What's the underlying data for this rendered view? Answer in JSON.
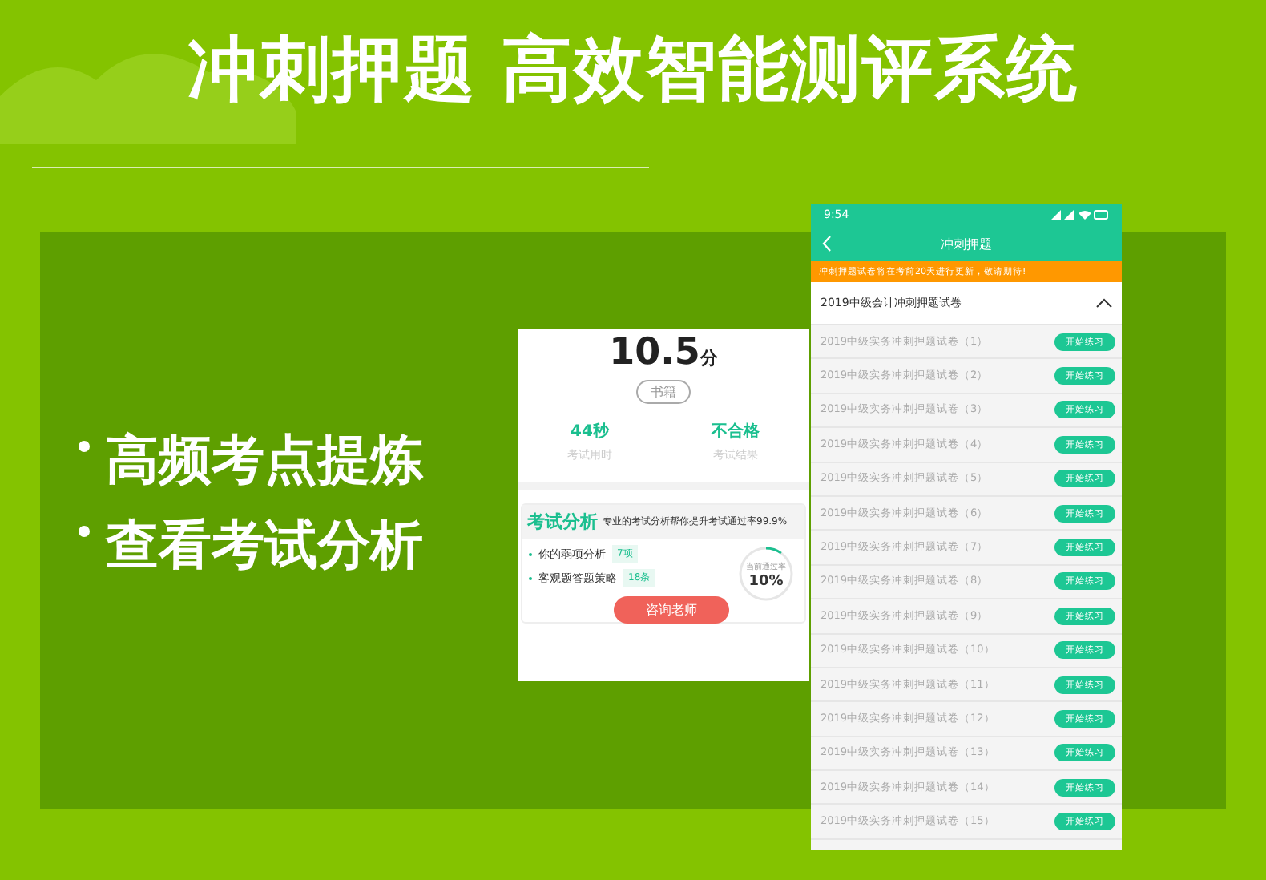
{
  "headline": "冲刺押题 高效智能测评系统",
  "features": [
    "高频考点提炼",
    "查看考试分析"
  ],
  "result_card": {
    "score": "10.5",
    "score_unit": "分",
    "tag": "书籍",
    "stats": [
      {
        "value": "44秒",
        "label": "考试用时"
      },
      {
        "value": "不合格",
        "label": "考试结果"
      }
    ],
    "analysis": {
      "title": "考试分析",
      "subtitle": "专业的考试分析帮你提升考试通过率99.9%",
      "items": [
        {
          "label": "你的弱项分析",
          "badge": "7项"
        },
        {
          "label": "客观题答题策略",
          "badge": "18条"
        }
      ],
      "gauge": {
        "caption": "当前通过率",
        "reading": "10%",
        "level": 0.1
      }
    },
    "button": "咨询老师"
  },
  "phone": {
    "status_bar": {
      "time": "9:54"
    },
    "title": "冲刺押题",
    "notice": "冲刺押题试卷将在考前20天进行更新，敬请期待!",
    "section": {
      "title": "2019中级会计冲刺押题试卷",
      "expanded": true
    },
    "rows": [
      {
        "title": "2019中级实务冲刺押题试卷（1）",
        "action": "开始练习"
      },
      {
        "title": "2019中级实务冲刺押题试卷（2）",
        "action": "开始练习"
      },
      {
        "title": "2019中级实务冲刺押题试卷（3）",
        "action": "开始练习"
      },
      {
        "title": "2019中级实务冲刺押题试卷（4）",
        "action": "开始练习"
      },
      {
        "title": "2019中级实务冲刺押题试卷（5）",
        "action": "开始练习"
      },
      {
        "title": "2019中级实务冲刺押题试卷（6）",
        "action": "开始练习"
      },
      {
        "title": "2019中级实务冲刺押题试卷（7）",
        "action": "开始练习"
      },
      {
        "title": "2019中级实务冲刺押题试卷（8）",
        "action": "开始练习"
      },
      {
        "title": "2019中级实务冲刺押题试卷（9）",
        "action": "开始练习"
      },
      {
        "title": "2019中级实务冲刺押题试卷（10）",
        "action": "开始练习"
      },
      {
        "title": "2019中级实务冲刺押题试卷（11）",
        "action": "开始练习"
      },
      {
        "title": "2019中级实务冲刺押题试卷（12）",
        "action": "开始练习"
      },
      {
        "title": "2019中级实务冲刺押题试卷（13）",
        "action": "开始练习"
      },
      {
        "title": "2019中级实务冲刺押题试卷（14）",
        "action": "开始练习"
      },
      {
        "title": "2019中级实务冲刺押题试卷（15）",
        "action": "开始练习"
      }
    ]
  }
}
